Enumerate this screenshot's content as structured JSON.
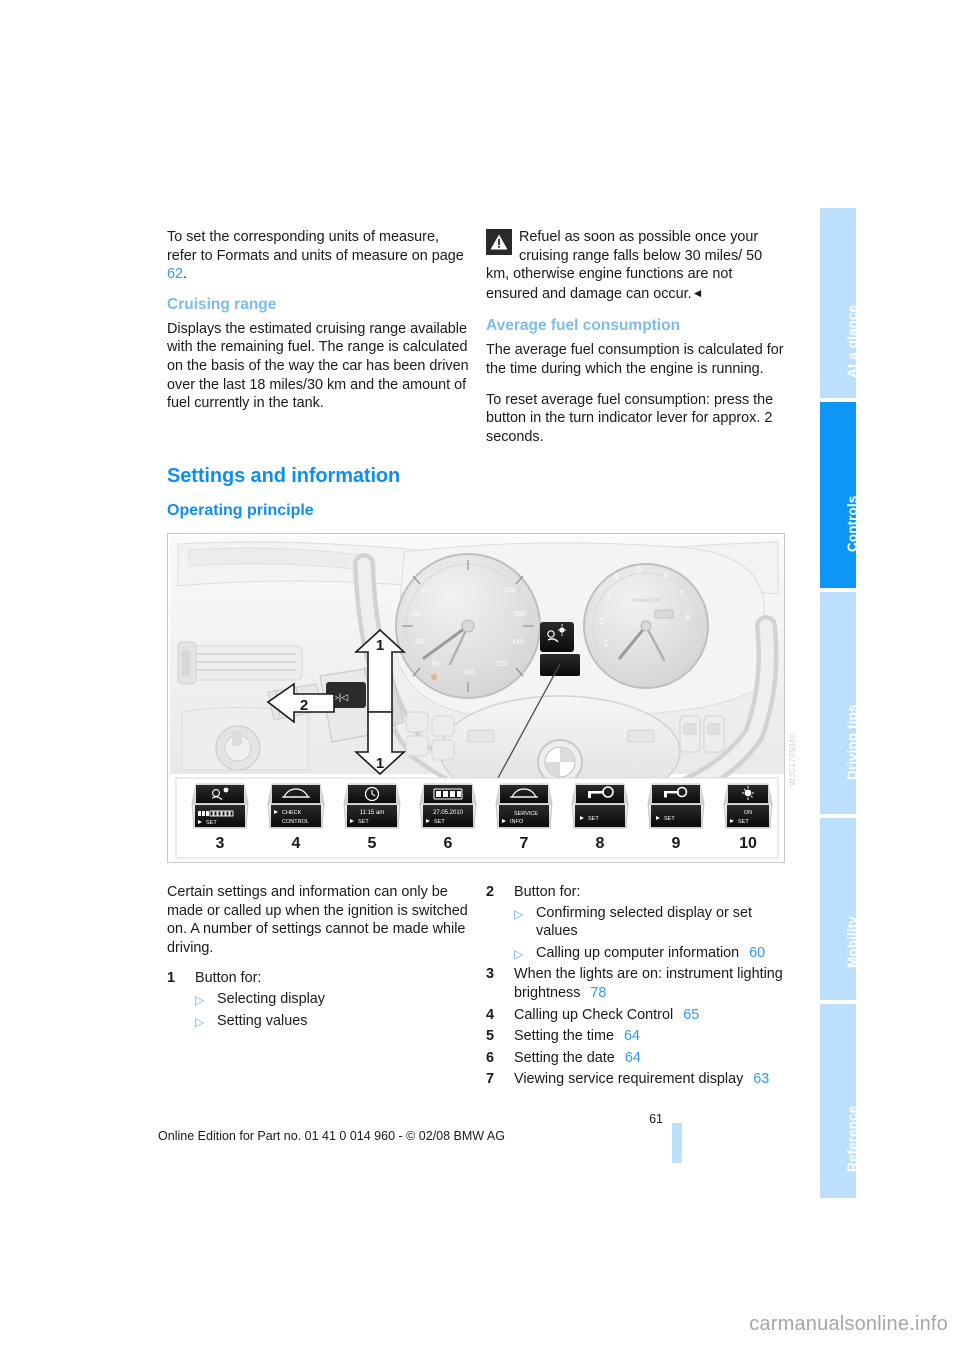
{
  "document": {
    "page_number": "61",
    "footer_line": "Online Edition for Part no. 01 41 0 014 960 - © 02/08 BMW AG",
    "site_watermark": "carmanualsonline.info",
    "figure_code": "WJC1705040"
  },
  "colors": {
    "section_heading": "#0d8ff0",
    "sub_heading": "#7cbcef",
    "link": "#2f9bf2",
    "tab_active": "#0d96f5",
    "tab_inactive": "#bcdffb",
    "footer_bar": "#bcdffb",
    "body_text": "#1a1a1a"
  },
  "tab_rail": {
    "items": [
      {
        "label": "At a glance",
        "active": false
      },
      {
        "label": "Controls",
        "active": true
      },
      {
        "label": "Driving tips",
        "active": false
      },
      {
        "label": "Mobility",
        "active": false
      },
      {
        "label": "Reference",
        "active": false
      }
    ]
  },
  "left_column": {
    "intro_paragraph_pre": "To set the corresponding units of measure, refer to Formats and units of measure on page ",
    "intro_page_link": "62",
    "intro_paragraph_post": ".",
    "cruising_range": {
      "heading": "Cruising range",
      "body": "Displays the estimated cruising range available with the remaining fuel. The range is calculated on the basis of the way the car has been driven over the last 18 miles/30 km and the amount of fuel currently in the tank."
    }
  },
  "right_column": {
    "warning": {
      "icon": "warning-triangle-icon",
      "text": "Refuel as soon as possible once your cruising range falls below 30 miles/ 50 km, otherwise engine functions are not ensured and damage can occur.",
      "end_mark": "◄"
    },
    "average_fuel": {
      "heading": "Average fuel consumption",
      "paragraph1": "The average fuel consumption is calculated for the time during which the engine is running.",
      "paragraph2": "To reset average fuel consumption: press the button in the turn indicator lever for approx. 2 seconds."
    }
  },
  "section": {
    "title": "Settings and information",
    "subtitle": "Operating principle"
  },
  "below_figure": {
    "left": {
      "paragraph": "Certain settings and information can only be made or called up when the ignition is switched on. A number of settings cannot be made while driving.",
      "item_1": {
        "num": "1",
        "label": "Button for:",
        "bullets": [
          {
            "arrow": "▷",
            "text": "Selecting display",
            "page": ""
          },
          {
            "arrow": "▷",
            "text": "Setting values",
            "page": ""
          }
        ]
      }
    },
    "right_items": [
      {
        "num": "2",
        "label": "Button for:",
        "bullets": [
          {
            "arrow": "▷",
            "text": "Confirming selected display or set values",
            "page": ""
          },
          {
            "arrow": "▷",
            "text": "Calling up computer information",
            "page": "60"
          }
        ]
      },
      {
        "num": "3",
        "label": "When the lights are on: instrument lighting brightness",
        "page": "78"
      },
      {
        "num": "4",
        "label": "Calling up Check Control",
        "page": "65"
      },
      {
        "num": "5",
        "label": "Setting the time",
        "page": "64"
      },
      {
        "num": "6",
        "label": "Setting the date",
        "page": "64"
      },
      {
        "num": "7",
        "label": "Viewing service requirement display",
        "page": "63"
      }
    ]
  },
  "figure": {
    "alt": "Dashboard with steering wheel, instrument cluster and turn indicator lever; callouts 1 and 2 on the lever, display icons 3 to 10 in a strip below",
    "callouts": [
      {
        "id": "1",
        "kind": "arrow-up"
      },
      {
        "id": "2",
        "kind": "arrow-left"
      },
      {
        "id": "1",
        "kind": "arrow-down"
      }
    ],
    "display_strip": [
      {
        "num": "3",
        "icon": "brightness-gauge-icon",
        "text": "SET"
      },
      {
        "num": "4",
        "icon": "car-icon",
        "text": "CHECK CONTROL"
      },
      {
        "num": "5",
        "icon": "clock-icon",
        "text": "11:15 am SET"
      },
      {
        "num": "6",
        "icon": "date-icon",
        "text": "27.05.2010 SET"
      },
      {
        "num": "7",
        "icon": "car-service-icon",
        "text": "SERVICE INFO"
      },
      {
        "num": "8",
        "icon": "key-lock-icon",
        "text": "SET"
      },
      {
        "num": "9",
        "icon": "key-icon",
        "text": "SET"
      },
      {
        "num": "10",
        "icon": "lamp-icon",
        "text": "ON SET"
      }
    ]
  }
}
